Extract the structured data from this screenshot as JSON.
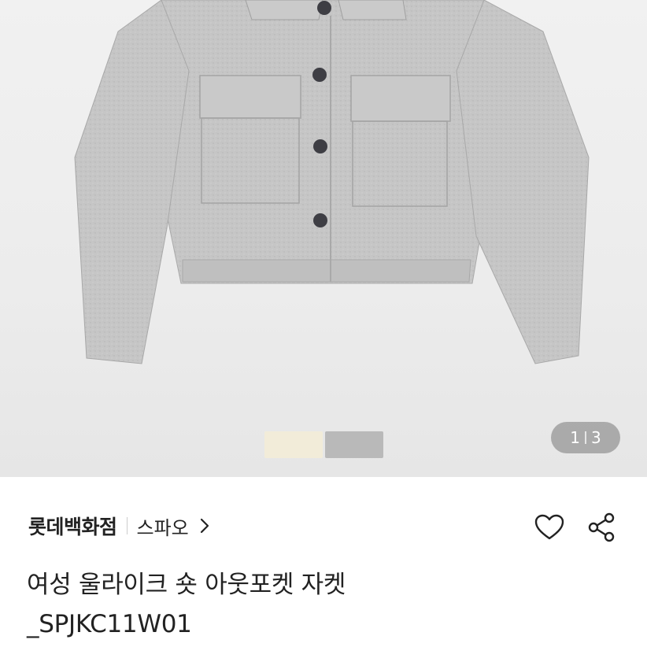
{
  "gallery": {
    "counter_current": "1",
    "counter_total": "3",
    "swatches": [
      {
        "name": "cream",
        "color": "#f2ecd9"
      },
      {
        "name": "gray",
        "color": "#b9b9b9"
      }
    ]
  },
  "product": {
    "brand": "롯데백화점",
    "store": "스파오",
    "title_line1": "여성 울라이크 숏 아웃포켓 자켓",
    "title_line2": "_SPJKC11W01"
  },
  "icons": {
    "store_link": "chevron-right-icon",
    "wishlist": "heart-icon",
    "share": "share-icon"
  }
}
